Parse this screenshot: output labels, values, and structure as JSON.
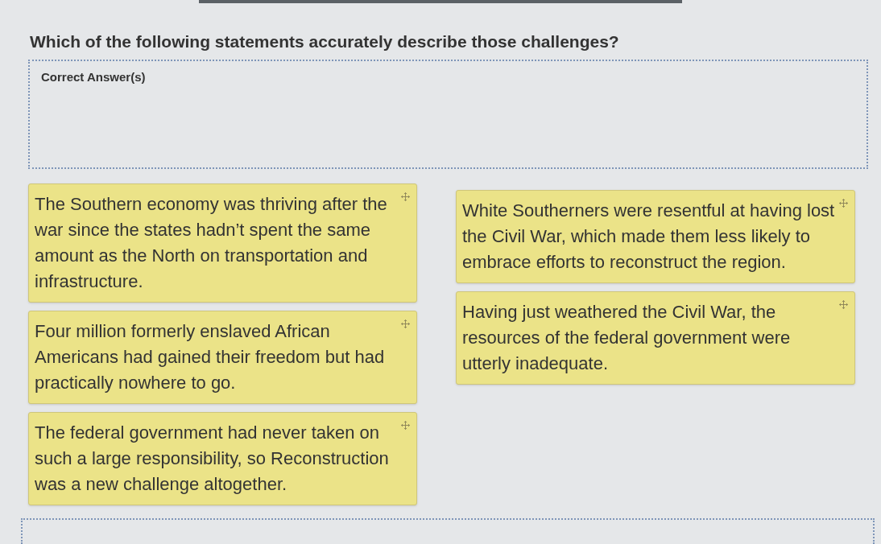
{
  "question": "Which of the following statements accurately describe those challenges?",
  "answer_zone": {
    "label": "Correct Answer(s)"
  },
  "option_columns": [
    {
      "items": [
        {
          "text": "The Southern economy was thriving after the war since the states hadn’t spent the same amount as the North on transportation and infrastructure."
        },
        {
          "text": "Four million formerly enslaved African Americans had gained their freedom but had practically nowhere to go."
        },
        {
          "text": "The federal government had never taken on such a large responsibility, so Reconstruction was a new challenge altogether."
        }
      ]
    },
    {
      "items": [
        {
          "text": "White Southerners were resentful at having lost the Civil War, which made them less likely to embrace efforts to reconstruct the region."
        },
        {
          "text": "Having just weathered the Civil War, the resources of the federal government were utterly inadequate."
        }
      ]
    }
  ]
}
